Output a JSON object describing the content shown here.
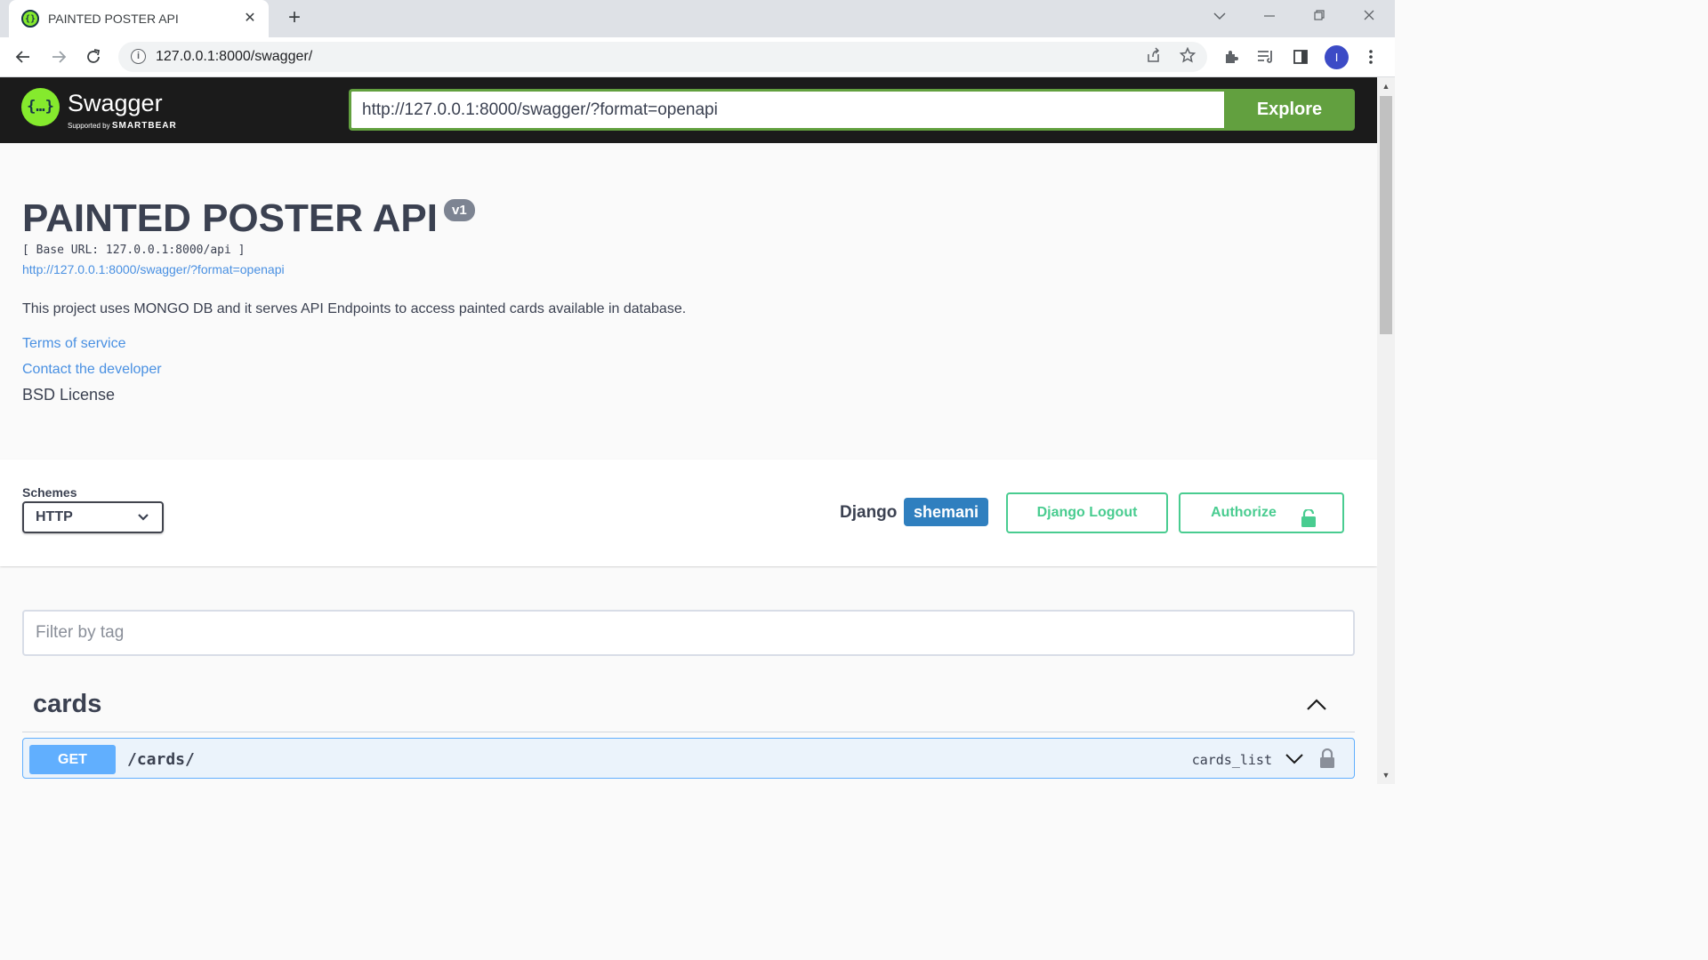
{
  "browser": {
    "tab_title": "PAINTED POSTER API",
    "tab_close": "✕",
    "new_tab": "+",
    "address": "127.0.0.1:8000/swagger/",
    "profile_initial": "I"
  },
  "topbar": {
    "brand": "Swagger",
    "supported_by": "Supported by",
    "supporter": "SMARTBEAR",
    "spec_url": "http://127.0.0.1:8000/swagger/?format=openapi",
    "explore_label": "Explore"
  },
  "info": {
    "title": "PAINTED POSTER API",
    "version": "v1",
    "base_url": "[ Base URL: 127.0.0.1:8000/api ]",
    "spec_link": "http://127.0.0.1:8000/swagger/?format=openapi",
    "description": "This project uses MONGO DB and it serves API Endpoints to access painted cards available in database.",
    "terms": "Terms of service",
    "contact": "Contact the developer",
    "license": "BSD License"
  },
  "schemes": {
    "label": "Schemes",
    "selected": "HTTP",
    "django_label": "Django",
    "username": "shemani",
    "logout_label": "Django Logout",
    "authorize_label": "Authorize"
  },
  "filter": {
    "placeholder": "Filter by tag"
  },
  "tags": [
    {
      "name": "cards",
      "operations": [
        {
          "method": "GET",
          "path": "/cards/",
          "operation_id": "cards_list"
        }
      ]
    }
  ],
  "colors": {
    "swagger_green": "#85ea2d",
    "explore_green": "#62a03f",
    "authorize_green": "#49cc90",
    "get_blue": "#61affe",
    "user_badge": "#2f7fbf",
    "topbar_bg": "#1b1b1b"
  }
}
